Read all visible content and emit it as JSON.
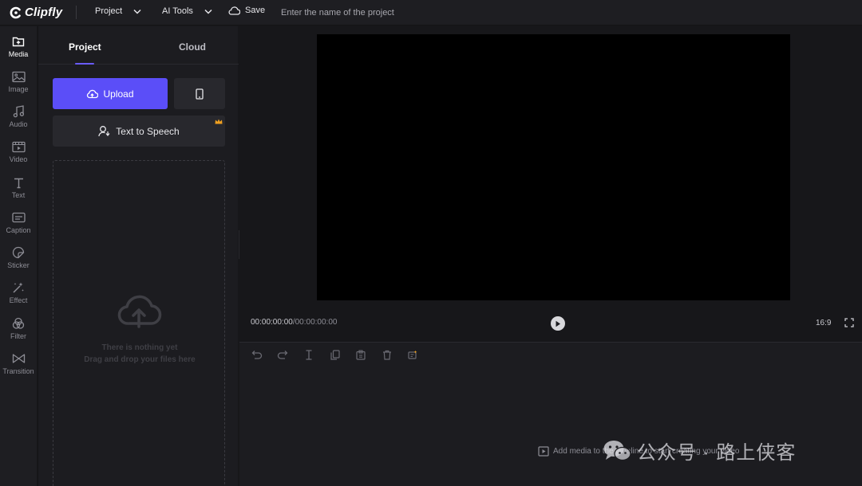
{
  "app": {
    "name": "Clipfly"
  },
  "topbar": {
    "menus": [
      {
        "label": "Project"
      },
      {
        "label": "AI Tools"
      }
    ],
    "save_label": "Save",
    "project_name_placeholder": "Enter the name of the project"
  },
  "rail": {
    "items": [
      {
        "label": "Media",
        "icon": "media-add-icon",
        "active": true
      },
      {
        "label": "Image",
        "icon": "image-icon"
      },
      {
        "label": "Audio",
        "icon": "music-note-icon"
      },
      {
        "label": "Video",
        "icon": "video-icon"
      },
      {
        "label": "Text",
        "icon": "text-icon"
      },
      {
        "label": "Caption",
        "icon": "caption-icon"
      },
      {
        "label": "Sticker",
        "icon": "sticker-icon"
      },
      {
        "label": "Effect",
        "icon": "magic-wand-icon"
      },
      {
        "label": "Filter",
        "icon": "filter-icon"
      },
      {
        "label": "Transition",
        "icon": "transition-icon"
      }
    ]
  },
  "panel": {
    "tabs": [
      {
        "label": "Project",
        "active": true
      },
      {
        "label": "Cloud"
      }
    ],
    "upload_label": "Upload",
    "tts_label": "Text to Speech",
    "dropzone": {
      "line1": "There is nothing yet",
      "line2": "Drag and drop your files here"
    }
  },
  "preview": {
    "current_time": "00:00:00:00",
    "separator": "/",
    "total_time": "00:00:00:00",
    "aspect_ratio": "16:9"
  },
  "timeline": {
    "tools": [
      "undo-icon",
      "redo-icon",
      "split-icon",
      "duplicate-icon",
      "copy-icon",
      "delete-icon",
      "ai-tool-icon"
    ],
    "hint": "Add media to the timeline to start creating your video"
  },
  "watermark": {
    "text": "公众号 · 路上侠客"
  },
  "colors": {
    "accent": "#5b4ef8",
    "background": "#17171a",
    "panel": "#1c1c20",
    "crown": "#f0a020"
  }
}
